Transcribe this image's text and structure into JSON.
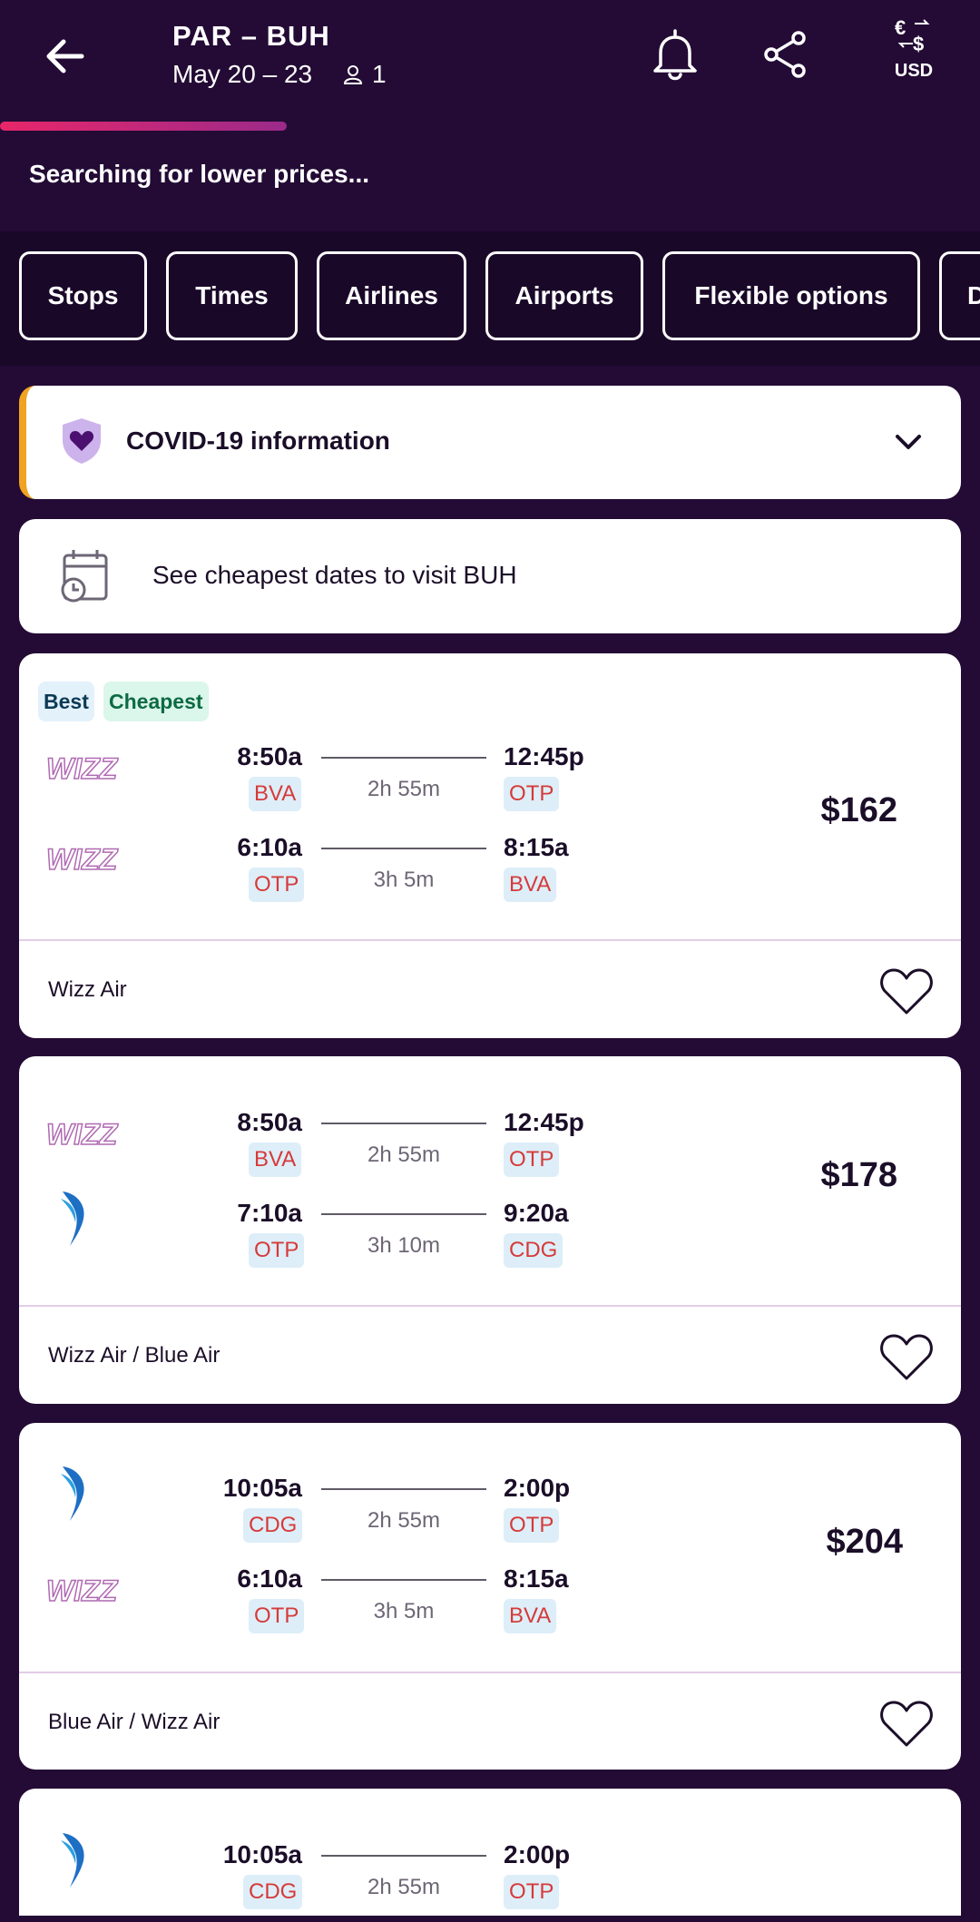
{
  "header": {
    "route": "PAR – BUH",
    "dates": "May 20 – 23",
    "passengers": "1",
    "currency": "USD",
    "status": "Searching for lower prices..."
  },
  "filters": [
    "Stops",
    "Times",
    "Airlines",
    "Airports",
    "Flexible options",
    "D"
  ],
  "covid": {
    "title": "COVID-19 information"
  },
  "cheapest_dates": {
    "title": "See cheapest dates to visit BUH"
  },
  "badges": {
    "best": "Best",
    "cheapest": "Cheapest"
  },
  "results": [
    {
      "price": "$162",
      "airlines": "Wizz Air",
      "legs": [
        {
          "logo": "wizz-logo",
          "dep": "8:50a",
          "dep_code": "BVA",
          "duration": "2h 55m",
          "arr": "12:45p",
          "arr_code": "OTP"
        },
        {
          "logo": "wizz-logo",
          "dep": "6:10a",
          "dep_code": "OTP",
          "duration": "3h 5m",
          "arr": "8:15a",
          "arr_code": "BVA"
        }
      ]
    },
    {
      "price": "$178",
      "airlines": "Wizz Air / Blue Air",
      "legs": [
        {
          "logo": "wizz-logo",
          "dep": "8:50a",
          "dep_code": "BVA",
          "duration": "2h 55m",
          "arr": "12:45p",
          "arr_code": "OTP"
        },
        {
          "logo": "blue-air-logo",
          "dep": "7:10a",
          "dep_code": "OTP",
          "duration": "3h 10m",
          "arr": "9:20a",
          "arr_code": "CDG"
        }
      ]
    },
    {
      "price": "$204",
      "airlines": "Blue Air / Wizz Air",
      "legs": [
        {
          "logo": "blue-air-logo",
          "dep": "10:05a",
          "dep_code": "CDG",
          "duration": "2h 55m",
          "arr": "2:00p",
          "arr_code": "OTP"
        },
        {
          "logo": "wizz-logo",
          "dep": "6:10a",
          "dep_code": "OTP",
          "duration": "3h 5m",
          "arr": "8:15a",
          "arr_code": "BVA"
        }
      ]
    },
    {
      "price": "",
      "airlines": "",
      "legs": [
        {
          "logo": "blue-air-logo",
          "dep": "10:05a",
          "dep_code": "CDG",
          "duration": "2h 55m",
          "arr": "2:00p",
          "arr_code": "OTP"
        }
      ]
    }
  ]
}
